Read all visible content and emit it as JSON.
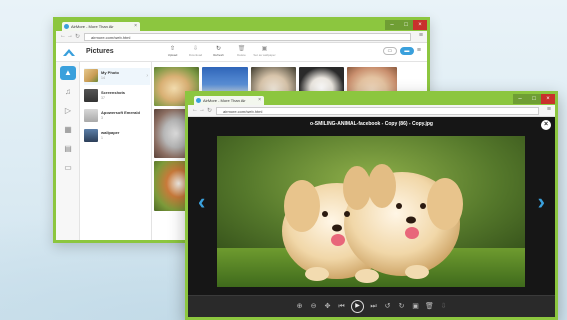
{
  "window1": {
    "tab_title": "AirMore - More Than Air",
    "url": "airmore.com/web.html",
    "app_title": "Pictures",
    "toolbar": [
      {
        "label": "Upload",
        "icon": "upload-icon",
        "enabled": true
      },
      {
        "label": "Download",
        "icon": "download-icon",
        "enabled": false
      },
      {
        "label": "Refresh",
        "icon": "refresh-icon",
        "enabled": true
      },
      {
        "label": "Delete",
        "icon": "delete-icon",
        "enabled": false
      },
      {
        "label": "Set as wallpaper",
        "icon": "wallpaper-icon",
        "enabled": false
      }
    ],
    "albums": [
      {
        "name": "My Photo",
        "count": "14"
      },
      {
        "name": "Screenshots",
        "count": "37"
      },
      {
        "name": "Apowersoft Emerald",
        "count": "3"
      },
      {
        "name": "wallpaper",
        "count": "1"
      }
    ],
    "rail_icons": [
      "photos-icon",
      "music-icon",
      "video-icon",
      "apps-icon",
      "documents-icon",
      "files-icon"
    ]
  },
  "window2": {
    "tab_title": "AirMore - More Than Air",
    "url": "airmore.com/web.html",
    "image_title": "o-SMILING-ANIMAL-facebook - Copy (86) - Copy.jpg",
    "controls": [
      "zoom-in-icon",
      "zoom-out-icon",
      "fit-icon",
      "previous-icon",
      "play-icon",
      "next-icon",
      "rotate-left-icon",
      "rotate-right-icon",
      "wallpaper-icon",
      "delete-icon",
      "download-icon"
    ]
  },
  "colors": {
    "frame": "#8cc63f",
    "accent": "#3aa0dc",
    "close": "#c9302c"
  }
}
